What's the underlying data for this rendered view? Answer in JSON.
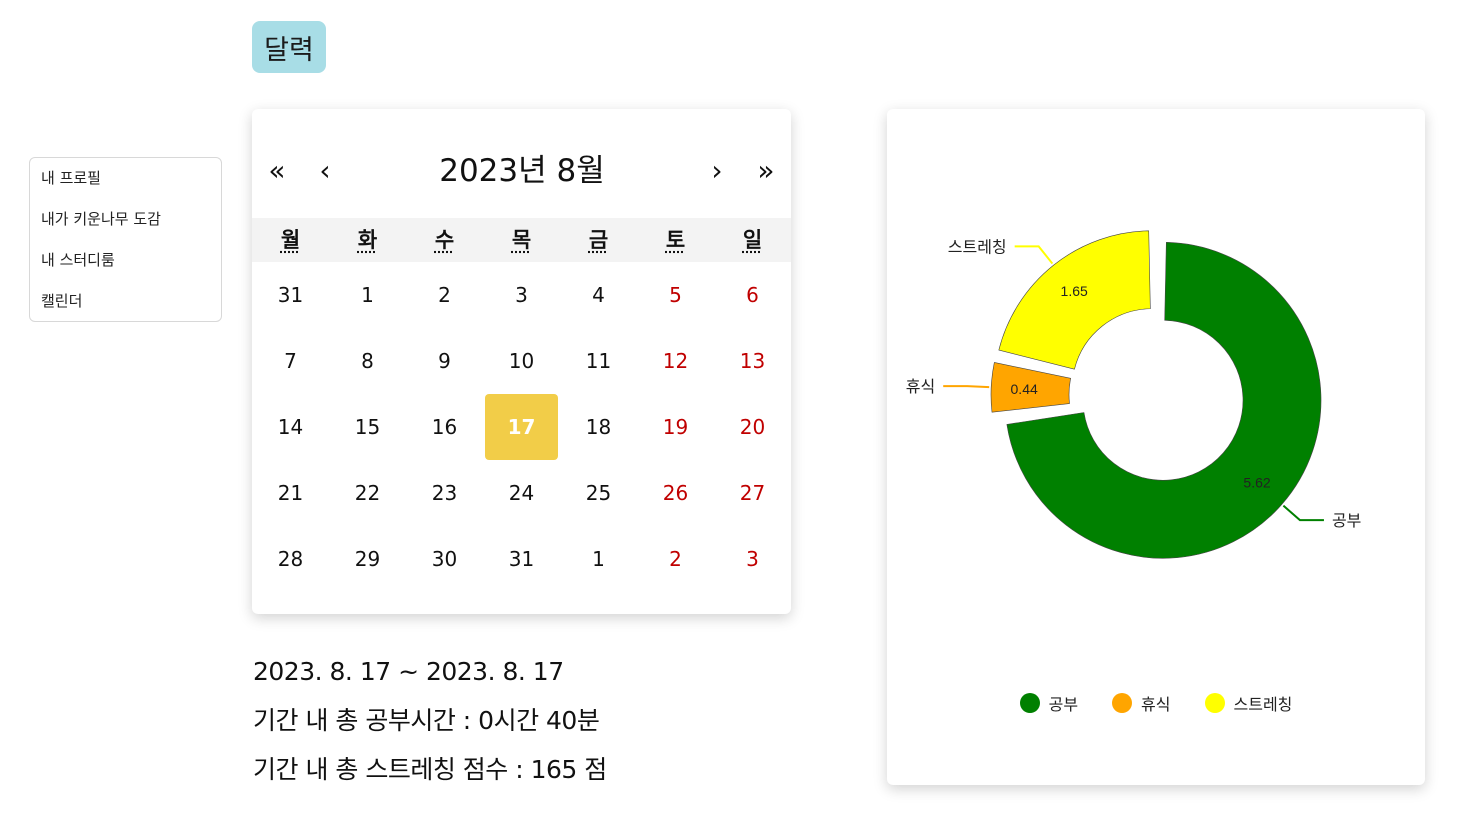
{
  "page_title": "달력",
  "sidebar": {
    "items": [
      {
        "label": "내 프로필"
      },
      {
        "label": "내가 키운나무 도감"
      },
      {
        "label": "내 스터디룸"
      },
      {
        "label": "캘린더"
      }
    ]
  },
  "calendar": {
    "nav": {
      "prev_year": "«",
      "prev_month": "‹",
      "next_month": "›",
      "next_year": "»"
    },
    "month_label": "2023년 8월",
    "weekdays": [
      "월",
      "화",
      "수",
      "목",
      "금",
      "토",
      "일"
    ],
    "weeks": [
      [
        "31",
        "1",
        "2",
        "3",
        "4",
        "5",
        "6"
      ],
      [
        "7",
        "8",
        "9",
        "10",
        "11",
        "12",
        "13"
      ],
      [
        "14",
        "15",
        "16",
        "17",
        "18",
        "19",
        "20"
      ],
      [
        "21",
        "22",
        "23",
        "24",
        "25",
        "26",
        "27"
      ],
      [
        "28",
        "29",
        "30",
        "31",
        "1",
        "2",
        "3"
      ]
    ],
    "selected_day": "17",
    "weekend_color": "#c00000",
    "selected_color": "#f2cd48"
  },
  "summary": {
    "range": "2023. 8. 17 ~ 2023. 8. 17",
    "study_time": "기간 내 총 공부시간 : 0시간 40분",
    "stretch_score": "기간 내 총 스트레칭 점수 : 165 점"
  },
  "chart_data": {
    "type": "pie",
    "style": "donut",
    "slices": [
      {
        "label": "공부",
        "value": 5.62,
        "value_label": "5.62",
        "color": "#008000"
      },
      {
        "label": "휴식",
        "value": 0.44,
        "value_label": "0.44",
        "color": "#ffa500"
      },
      {
        "label": "스트레칭",
        "value": 1.65,
        "value_label": "1.65",
        "color": "#ffff00"
      }
    ],
    "legend_position": "bottom"
  }
}
